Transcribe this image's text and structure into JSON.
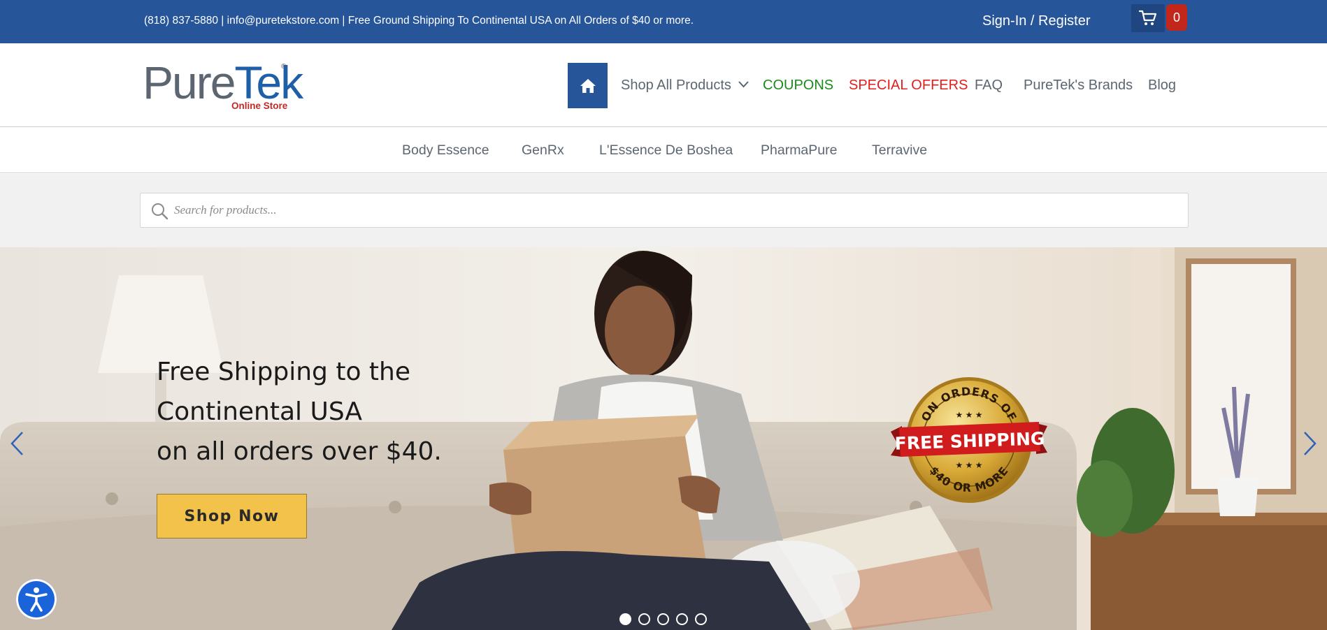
{
  "topbar": {
    "contact": "(818) 837-5880 | info@puretekstore.com | Free Ground Shipping To Continental USA on All Orders of $40 or more.",
    "signin": "Sign-In / Register",
    "cart_icon": "cart-icon",
    "cart_count": "0"
  },
  "logo": {
    "brand_main": "Pure",
    "brand_accent": "Tek",
    "registered": "®",
    "subtitle": "Online Store"
  },
  "nav": {
    "home_icon": "home-icon",
    "shop_all": "Shop All Products",
    "coupons": "COUPONS",
    "special_offers": "SPECIAL OFFERS",
    "faq": "FAQ",
    "brands": "PureTek's Brands",
    "blog": "Blog"
  },
  "brand_links": [
    "Body Essence",
    "GenRx",
    "L'Essence De Boshea",
    "PharmaPure",
    "Terravive"
  ],
  "search": {
    "placeholder": "Search for products...",
    "value": ""
  },
  "hero": {
    "title_lines": [
      "Free Shipping to the",
      "Continental USA",
      "on all orders over $40."
    ],
    "button": "Shop Now",
    "badge": {
      "top": "ON ORDERS OF",
      "ribbon": "FREE SHIPPING",
      "bottom": "$40 OR MORE"
    },
    "slides_total": 5,
    "active_slide": 1
  },
  "colors": {
    "topbar": "#26559a",
    "coupons": "#1a8a1a",
    "offers": "#e01e1e",
    "cta": "#f2c24a",
    "cart_badge": "#c3261a"
  },
  "accessibility": {
    "icon": "accessibility-icon"
  }
}
